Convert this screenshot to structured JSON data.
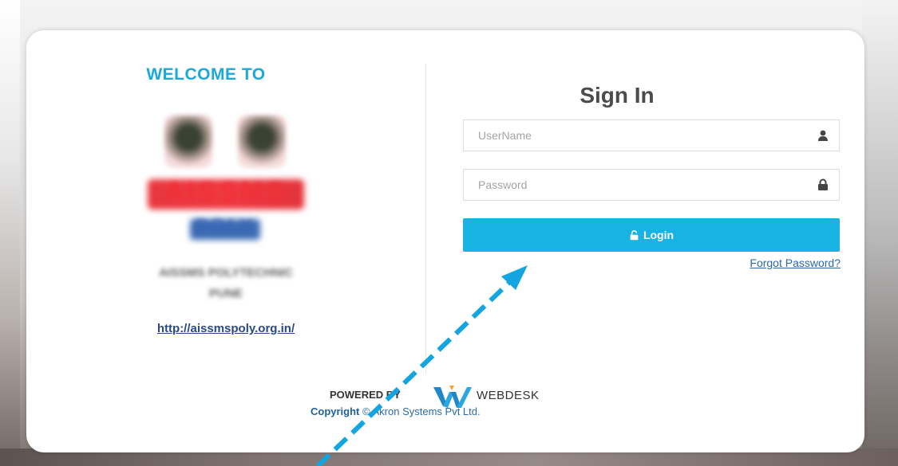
{
  "left_panel": {
    "welcome": "WELCOME TO",
    "logo_brand": "AISSMS",
    "logo_sub": "POLY",
    "college_name_line1": "AISSMS POLYTECHNIC",
    "college_name_line2": "PUNE",
    "site_link": "http://aissmspoly.org.in/"
  },
  "signin": {
    "title": "Sign In",
    "username_placeholder": "UserName",
    "username_value": "",
    "username_icon": "user-icon",
    "password_placeholder": "Password",
    "password_value": "",
    "password_icon": "lock-icon",
    "login_label": "Login",
    "login_icon": "unlock-icon",
    "forgot_label": "Forgot Password?"
  },
  "footer": {
    "powered_by": "POWERED BY",
    "brand": "WEBDESK",
    "copyright_prefix": "Copyright",
    "copyright_symbol": "©",
    "copyright_owner": "Akron Systems Pvt Ltd."
  },
  "colors": {
    "accent": "#16b3e3",
    "welcome_text": "#1ba9dc",
    "link": "#2d6aa3",
    "arrow": "#12a5e0"
  }
}
